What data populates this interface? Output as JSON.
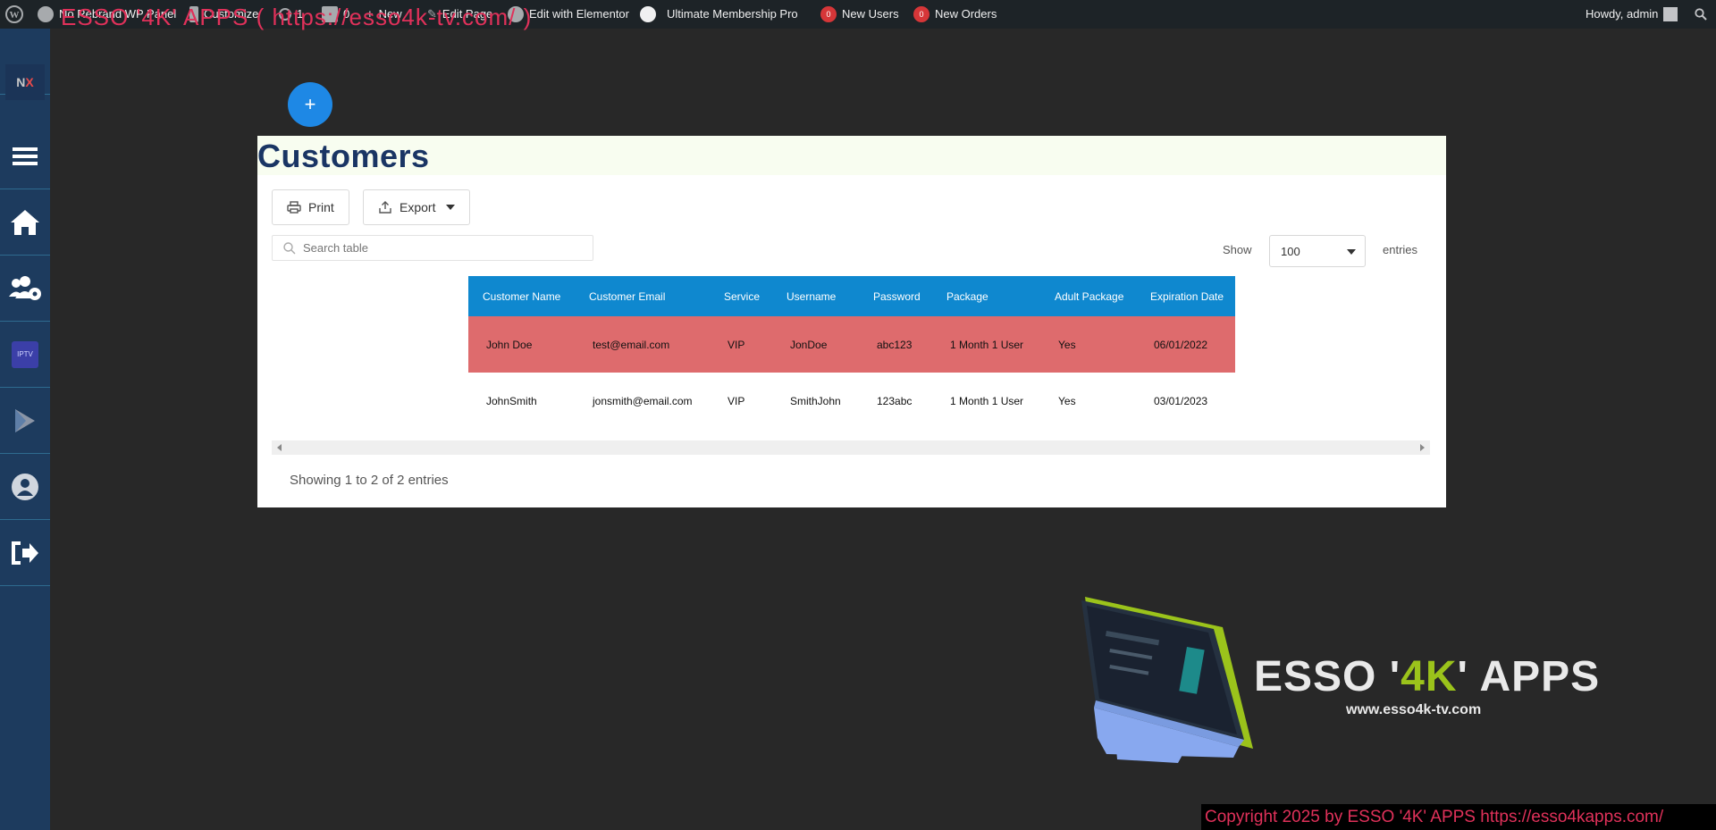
{
  "admin_bar": {
    "items": [
      {
        "label": "No Rebrand WP Panel"
      },
      {
        "label": "Customize"
      },
      {
        "label": "1"
      },
      {
        "label": "0"
      },
      {
        "label": "New"
      },
      {
        "label": "Edit Page"
      },
      {
        "label": "Edit with Elementor"
      },
      {
        "label": "Ultimate Membership Pro"
      },
      {
        "label": "New Users",
        "count": "0"
      },
      {
        "label": "New Orders",
        "count": "0"
      }
    ],
    "greeting": "Howdy, admin",
    "site_overlay": "ESSO '4K' APPS ( https://esso4k-tv.com/ )"
  },
  "sidebar": {
    "logo_text": "NX",
    "items": [
      {
        "icon": "menu-icon"
      },
      {
        "icon": "home-icon"
      },
      {
        "icon": "users-settings-icon"
      },
      {
        "icon": "iptv-icon"
      },
      {
        "icon": "play-store-icon"
      },
      {
        "icon": "user-icon"
      },
      {
        "icon": "logout-icon"
      }
    ]
  },
  "page": {
    "title": "Customers",
    "add_label": "+"
  },
  "toolbar": {
    "print_label": "Print",
    "export_label": "Export",
    "search_placeholder": "Search table",
    "show_label": "Show",
    "entries_value": "100",
    "entries_label": "entries"
  },
  "table": {
    "columns": [
      "Customer Name",
      "Customer Email",
      "Service",
      "Username",
      "Password",
      "Package",
      "Adult Package",
      "Expiration Date"
    ],
    "rows": [
      [
        "John Doe",
        "test@email.com",
        "VIP",
        "JonDoe",
        "abc123",
        "1 Month 1 User",
        "Yes",
        "06/01/2022"
      ],
      [
        "JohnSmith",
        "jonsmith@email.com",
        "VIP",
        "SmithJohn",
        "123abc",
        "1 Month 1 User",
        "Yes",
        "03/01/2023"
      ]
    ],
    "info": "Showing 1 to 2 of 2 entries"
  },
  "brand": {
    "name_prefix": "ESSO '",
    "name_highlight": "4K",
    "name_suffix": "' APPS",
    "url": "www.esso4k-tv.com",
    "accent": "#9bc31b"
  },
  "footer": {
    "copyright": "Copyright 2025  by ESSO '4K' APPS https://esso4kapps.com/"
  },
  "colors": {
    "header_blue": "#0f88cf",
    "expired_row": "#de6b6d",
    "sidebar": "#1d3b5e",
    "title": "#1a3564"
  }
}
